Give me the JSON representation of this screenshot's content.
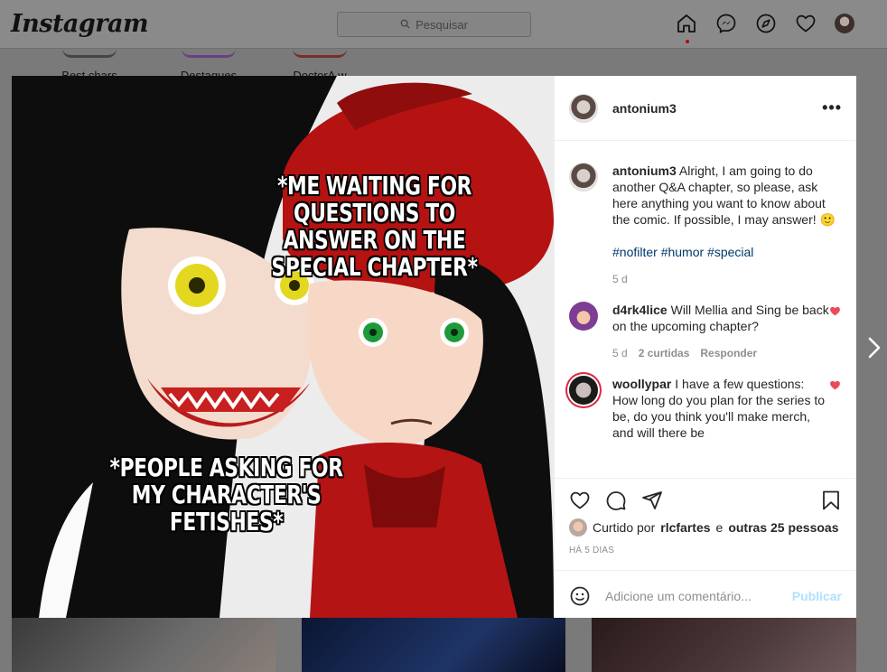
{
  "app": {
    "logo": "Instagram"
  },
  "search": {
    "placeholder": "Pesquisar"
  },
  "highlights": [
    {
      "label": "Best chars"
    },
    {
      "label": "Destaques"
    },
    {
      "label": "DoctorA w"
    }
  ],
  "nav": {
    "icons": [
      "home-icon",
      "messenger-icon",
      "explore-icon",
      "activity-heart-icon",
      "profile-avatar"
    ]
  },
  "post": {
    "username": "antonium3",
    "image_text_top": "*Me waiting for questions to answer on the special chapter*",
    "image_text_bottom": "*People asking for my character's fetishes*",
    "caption": {
      "username": "antonium3",
      "text": "Alright, I am going to do another Q&A chapter, so please, ask here anything you want to know about the comic. If possible, I may answer! 🙂",
      "tags": "#nofilter #humor #special",
      "time": "5 d"
    },
    "comments": [
      {
        "username": "d4rk4lice",
        "text": "Will Mellia and Sing be back on the upcoming chapter?",
        "time": "5 d",
        "likes": "2 curtidas",
        "reply": "Responder"
      },
      {
        "username": "woollypar",
        "text": "I have a few questions: How long do you plan for the series to be, do you think you'll make merch, and will there be"
      }
    ],
    "liked_by": {
      "prefix": "Curtido por",
      "user": "rlcfartes",
      "joiner": "e",
      "others": "outras 25 pessoas"
    },
    "posted_ago": "HÁ 5 DIAS",
    "add_comment_placeholder": "Adicione um comentário...",
    "publish_label": "Publicar"
  },
  "colors": {
    "accent_blue_disabled": "#b2dffc",
    "like_red": "#ed4956",
    "hashtag": "#00376b",
    "muted": "#8e8e8e"
  }
}
